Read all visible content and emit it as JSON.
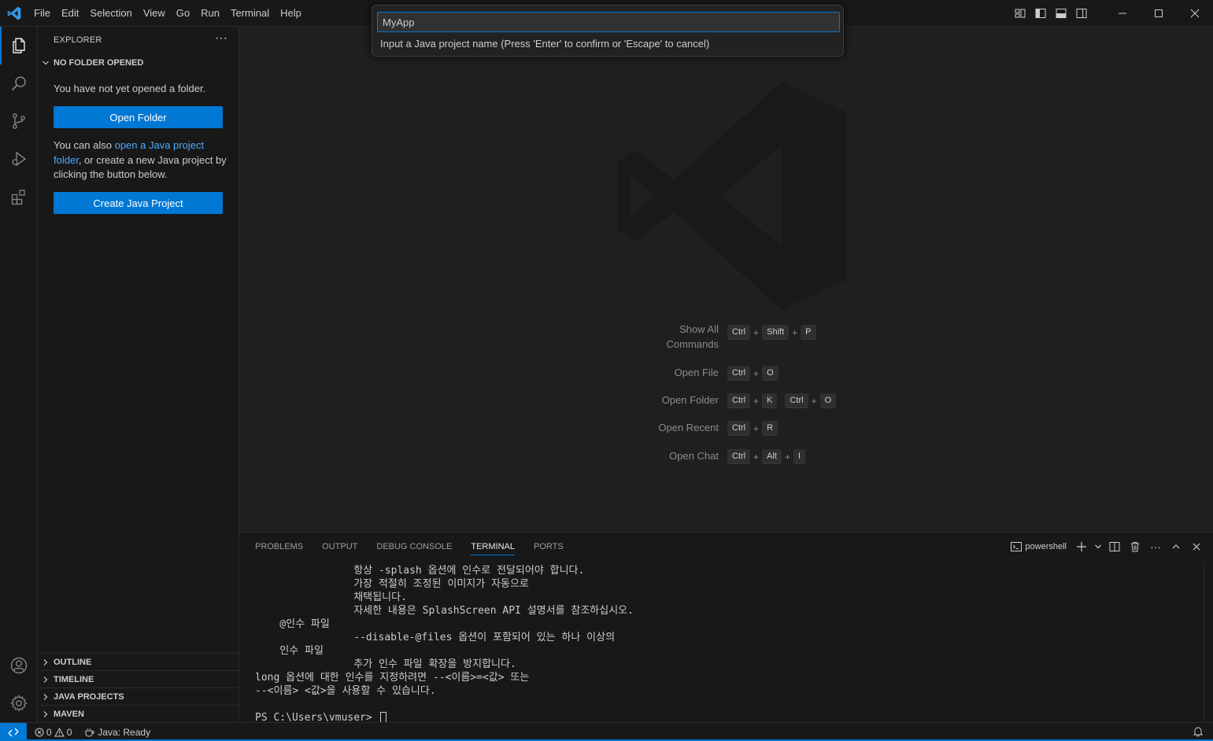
{
  "menu": [
    "File",
    "Edit",
    "Selection",
    "View",
    "Go",
    "Run",
    "Terminal",
    "Help"
  ],
  "sidebar": {
    "title": "EXPLORER",
    "section_header": "NO FOLDER OPENED",
    "no_folder_text": "You have not yet opened a folder.",
    "open_folder_button": "Open Folder",
    "java_text_prefix": "You can also ",
    "java_link": "open a Java project folder",
    "java_text_suffix": ", or create a new Java project by clicking the button below.",
    "create_java_button": "Create Java Project",
    "bottom_sections": [
      "OUTLINE",
      "TIMELINE",
      "JAVA PROJECTS",
      "MAVEN"
    ]
  },
  "quick_input": {
    "value": "MyApp",
    "message": "Input a Java project name (Press 'Enter' to confirm or 'Escape' to cancel)"
  },
  "editor": {
    "shortcuts": [
      {
        "label": "Show All\nCommands",
        "keys": [
          [
            "Ctrl",
            "Shift",
            "P"
          ]
        ]
      },
      {
        "label": "Open File",
        "keys": [
          [
            "Ctrl",
            "O"
          ]
        ]
      },
      {
        "label": "Open Folder",
        "keys": [
          [
            "Ctrl",
            "K"
          ],
          [
            "Ctrl",
            "O"
          ]
        ]
      },
      {
        "label": "Open Recent",
        "keys": [
          [
            "Ctrl",
            "R"
          ]
        ]
      },
      {
        "label": "Open Chat",
        "keys": [
          [
            "Ctrl",
            "Alt",
            "I"
          ]
        ]
      }
    ]
  },
  "panel": {
    "tabs": [
      "PROBLEMS",
      "OUTPUT",
      "DEBUG CONSOLE",
      "TERMINAL",
      "PORTS"
    ],
    "active_tab": "TERMINAL",
    "terminal_name": "powershell",
    "lines": [
      "                항상 -splash 옵션에 인수로 전달되어야 합니다.",
      "                가장 적절히 조정된 이미지가 자동으로",
      "                채택됩니다.",
      "                자세한 내용은 SplashScreen API 설명서를 참조하십시오.",
      "    @인수 파일",
      "                --disable-@files 옵션이 포함되어 있는 하나 이상의",
      "    인수 파일",
      "                추가 인수 파일 확장을 방지합니다.",
      "long 옵션에 대한 인수를 지정하려면 --<이름>=<값> 또는",
      "--<이름> <값>을 사용할 수 있습니다.",
      "",
      "PS C:\\Users\\vmuser> "
    ]
  },
  "statusbar": {
    "errors": "0",
    "warnings": "0",
    "java_status": "Java: Ready"
  }
}
